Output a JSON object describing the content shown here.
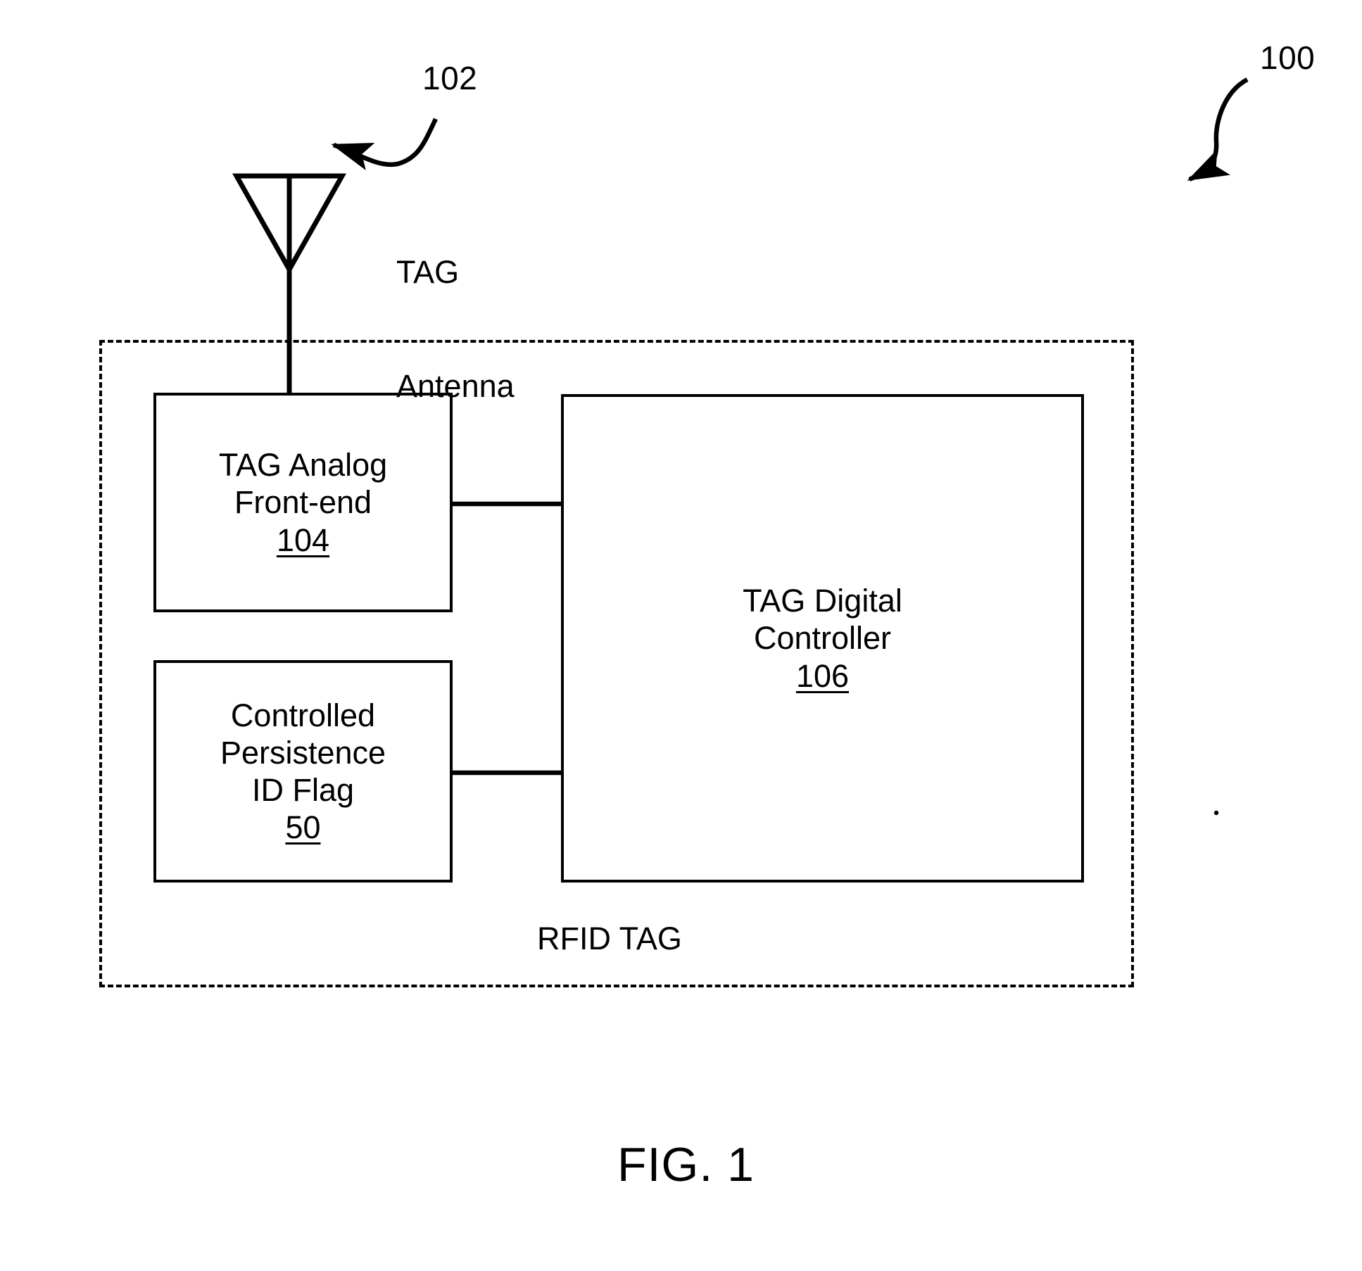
{
  "figure": {
    "caption": "FIG. 1",
    "overall_ref": "100",
    "enclosure_label": "RFID TAG"
  },
  "antenna": {
    "ref": "102",
    "label_line1": "TAG",
    "label_line2": "Antenna",
    "icon": "antenna-triangle-icon"
  },
  "blocks": [
    {
      "id": "tag-analog-front-end",
      "line1": "TAG Analog",
      "line2": "Front-end",
      "ref": "104"
    },
    {
      "id": "controlled-persistence-id-flag",
      "line1": "Controlled",
      "line2": "Persistence",
      "line3": "ID Flag",
      "ref": "50"
    },
    {
      "id": "tag-digital-controller",
      "line1": "TAG Digital",
      "line2": "Controller",
      "ref": "106"
    }
  ],
  "colors": {
    "ink": "#000000",
    "paper": "#ffffff"
  }
}
